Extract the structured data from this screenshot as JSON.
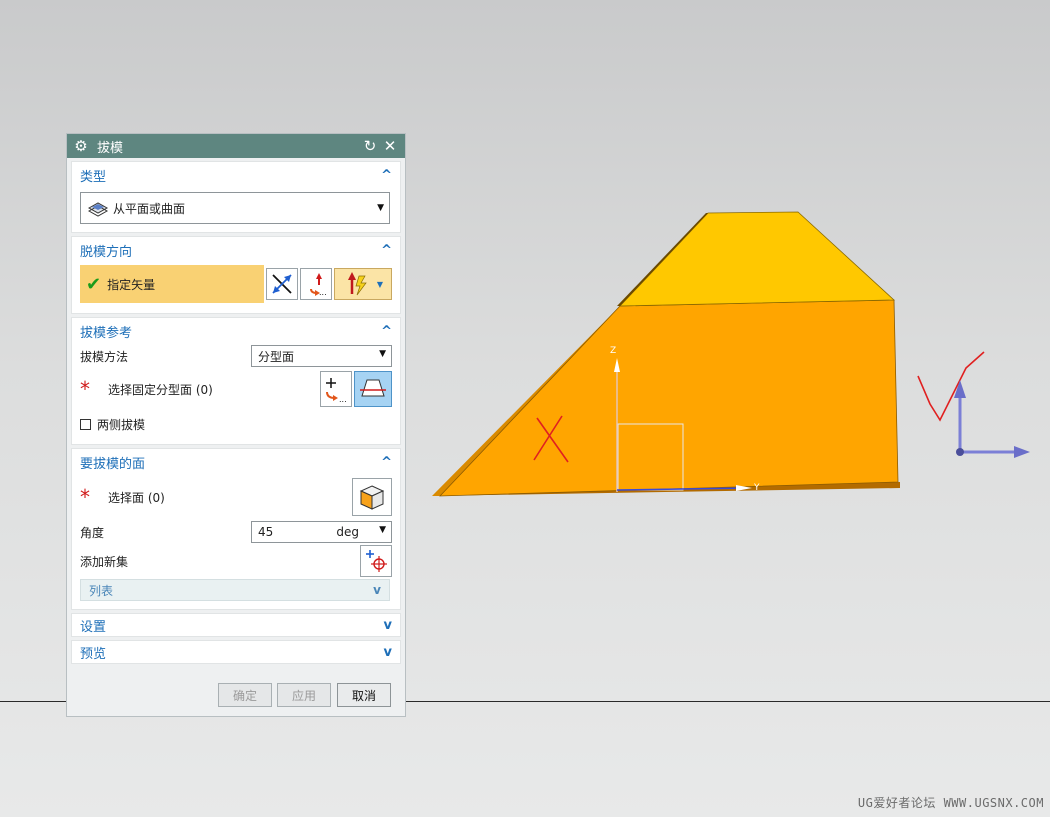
{
  "dialog": {
    "title": "拔模",
    "sections": {
      "type": {
        "label": "类型",
        "selected": "从平面或曲面"
      },
      "direction": {
        "label": "脱模方向",
        "specify_vector": "指定矢量"
      },
      "reference": {
        "label": "拔模参考",
        "method_label": "拔模方法",
        "method_value": "分型面",
        "select_label": "选择固定分型面 (0)",
        "both_sides_label": "两侧拔模"
      },
      "faces": {
        "label": "要拔模的面",
        "select_label": "选择面 (0)",
        "angle_label": "角度",
        "angle_value": "45",
        "angle_unit": "deg",
        "add_set_label": "添加新集",
        "list_label": "列表"
      },
      "settings": {
        "label": "设置"
      },
      "preview": {
        "label": "预览"
      }
    },
    "buttons": {
      "ok": "确定",
      "apply": "应用",
      "cancel": "取消"
    }
  },
  "viewport": {
    "axis_z": "Z",
    "axis_y": "Y"
  },
  "watermark": "UG爱好者论坛 WWW.UGSNX.COM",
  "colors": {
    "title_bar": "#5e8680",
    "section_header": "#1e6fb8",
    "highlight_row": "#f9d173",
    "model_front": "#ffa500",
    "model_top": "#ffc800",
    "model_slope": "#f59e0b",
    "annotation_red": "#e02020"
  }
}
